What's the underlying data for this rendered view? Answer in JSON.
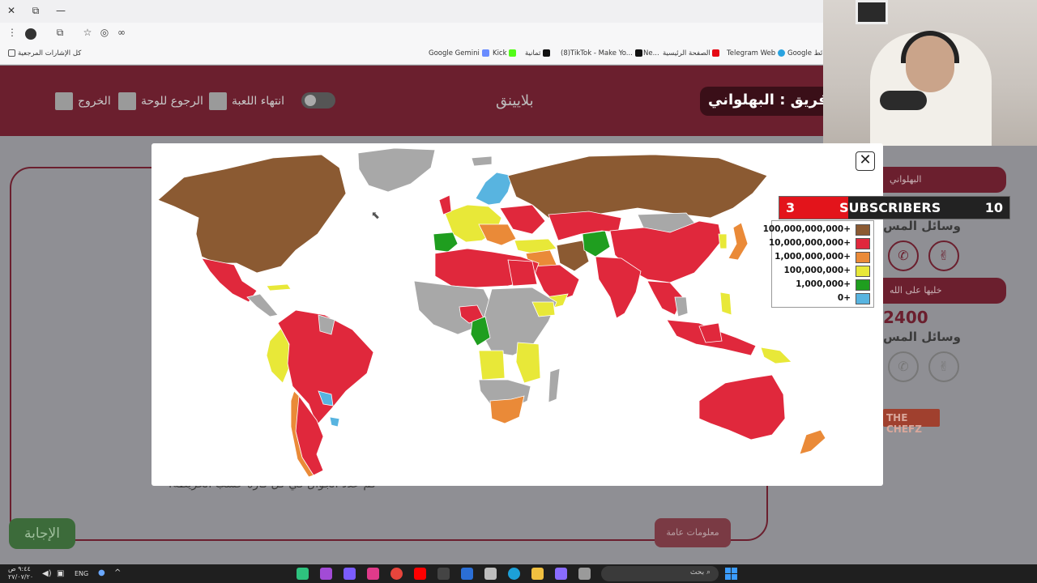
{
  "browser": {
    "win_close": "✕",
    "win_restore": "⧉",
    "win_minimize": "—",
    "bookmarks": [
      {
        "label": "كل الإشارات المرجعية",
        "color": "#555"
      },
      {
        "label": "Google Gemini",
        "color": "#6a8cff"
      },
      {
        "label": "Kick",
        "color": "#53fc18"
      },
      {
        "label": "ثمانية",
        "color": "#111"
      },
      {
        "label": "(8)TikTok - Make Yo...",
        "color": "#111"
      },
      {
        "label": "Ne...",
        "color": "#e50914"
      },
      {
        "label": "الصفحة الرئيسية",
        "color": "#e50914"
      },
      {
        "label": "Telegram Web",
        "color": "#2aa3e0"
      },
      {
        "label": "Google خرائط",
        "color": "#34a853"
      }
    ]
  },
  "header": {
    "exit_label": "الخروج",
    "board_label": "الرجوع للوحة",
    "end_game_label": "انتهاء اللعبة",
    "brand": "بلايينق",
    "team_label": "فريق : البهلواني"
  },
  "body": {
    "info_label": "معلومات عامة",
    "answer_label": "الإجابة",
    "question_text": "كم عدد الجوال في كل قارة حسب الخريطة؟"
  },
  "right_panel": {
    "team1_name": "البهلواني",
    "team1_means": "وسائل المس",
    "team2_name": "خليها على الله",
    "team2_score": "2400",
    "team2_means": "وسائل المس",
    "phone_icon": "✆",
    "peace_icon": "✌",
    "sponsor": "THE CHEFZ"
  },
  "modal": {
    "close_label": "✕",
    "legend": [
      {
        "label": "100,000,000,000+",
        "color": "#8b5a32"
      },
      {
        "label": "10,000,000,000+",
        "color": "#e0283c"
      },
      {
        "label": "1,000,000,000+",
        "color": "#ea8a38"
      },
      {
        "label": "100,000,000+",
        "color": "#e8e838"
      },
      {
        "label": "1,000,000+",
        "color": "#1f9e1f"
      },
      {
        "label": "0+",
        "color": "#58b4e0"
      }
    ],
    "no_data_color": "#a8a8a8"
  },
  "subscribers": {
    "current": "3",
    "title": "SUBSCRIBERS",
    "goal": "10",
    "progress": 0.3
  },
  "taskbar": {
    "search_label": "بحث",
    "lang": "ENG",
    "time": "٩:٤٤ ص",
    "date": "٢٧/٠٧/٢٠"
  }
}
